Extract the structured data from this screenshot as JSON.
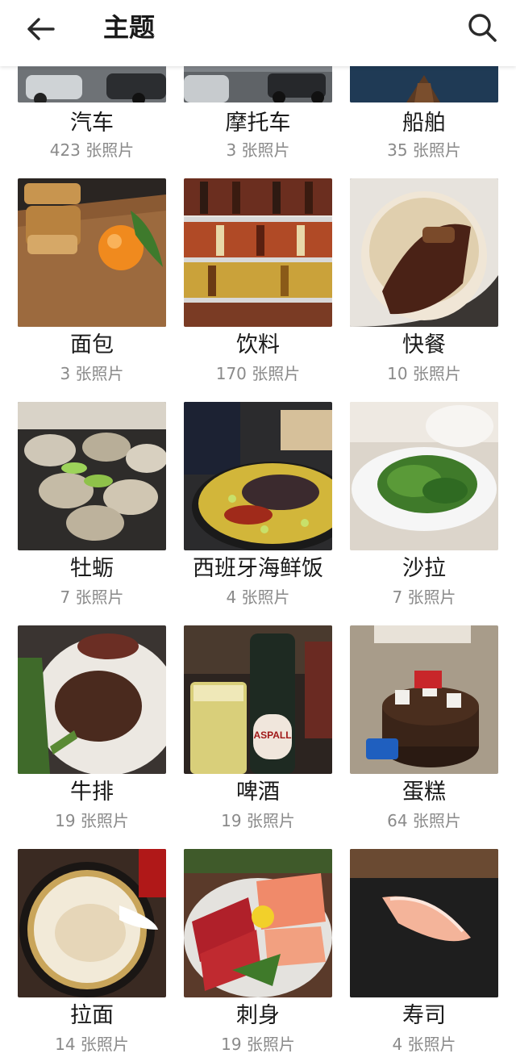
{
  "header": {
    "title": "主题",
    "back_icon": "arrow-left-icon",
    "search_icon": "search-icon"
  },
  "categories": [
    {
      "label": "汽车",
      "count": "423 张照片"
    },
    {
      "label": "摩托车",
      "count": "3 张照片"
    },
    {
      "label": "船舶",
      "count": "35 张照片"
    },
    {
      "label": "面包",
      "count": "3 张照片"
    },
    {
      "label": "饮料",
      "count": "170 张照片"
    },
    {
      "label": "快餐",
      "count": "10 张照片"
    },
    {
      "label": "牡蛎",
      "count": "7 张照片"
    },
    {
      "label": "西班牙海鲜饭",
      "count": "4 张照片"
    },
    {
      "label": "沙拉",
      "count": "7 张照片"
    },
    {
      "label": "牛排",
      "count": "19 张照片"
    },
    {
      "label": "啤酒",
      "count": "19 张照片"
    },
    {
      "label": "蛋糕",
      "count": "64 张照片"
    },
    {
      "label": "拉面",
      "count": "14 张照片"
    },
    {
      "label": "刺身",
      "count": "19 张照片"
    },
    {
      "label": "寿司",
      "count": "4 张照片"
    }
  ],
  "photo_texts": {
    "beer_brand": "ASPALL"
  }
}
